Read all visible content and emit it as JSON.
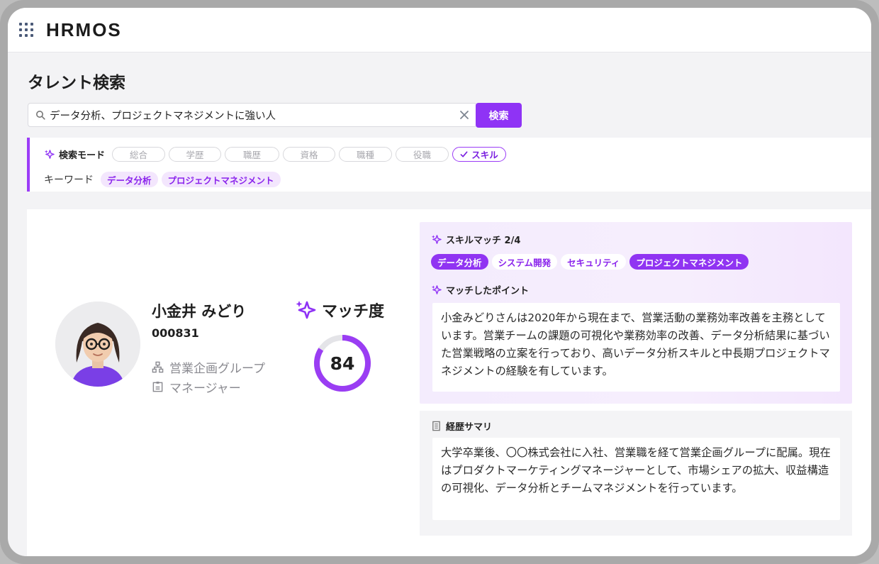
{
  "app": {
    "logo": "HRMOS"
  },
  "page": {
    "title": "タレント検索"
  },
  "search": {
    "value": "データ分析、プロジェクトマネジメントに強い人",
    "button": "検索"
  },
  "filter": {
    "mode_label": "検索モード",
    "modes": [
      "総合",
      "学歴",
      "職歴",
      "資格",
      "職種",
      "役職",
      "スキル"
    ],
    "active_mode": "スキル",
    "keyword_label": "キーワード",
    "keywords": [
      "データ分析",
      "プロジェクトマネジメント"
    ]
  },
  "result": {
    "name": "小金井 みどり",
    "employee_id": "000831",
    "department": "営業企画グループ",
    "position": "マネージャー",
    "match_label": "マッチ度",
    "match_score": 84,
    "skill_match": {
      "title": "スキルマッチ 2/4",
      "tags": [
        {
          "label": "データ分析",
          "matched": true
        },
        {
          "label": "システム開発",
          "matched": false
        },
        {
          "label": "セキュリティ",
          "matched": false
        },
        {
          "label": "プロジェクトマネジメント",
          "matched": true
        }
      ]
    },
    "points": {
      "title": "マッチしたポイント",
      "text": "小金みどりさんは2020年から現在まで、営業活動の業務効率改善を主務としています。営業チームの課題の可視化や業務効率の改善、データ分析結果に基づいた営業戦略の立案を行っており、高いデータ分析スキルと中長期プロジェクトマネジメントの経験を有しています。"
    },
    "career": {
      "title": "経歴サマリ",
      "text": "大学卒業後、〇〇株式会社に入社、営業職を経て営業企画グループに配属。現在はプロダクトマーケティングマネージャーとして、市場シェアの拡大、収益構造の可視化、データ分析とチームマネジメントを行っています。"
    }
  },
  "colors": {
    "accent": "#8f33f5",
    "accent_light": "#f3e6fd",
    "gauge_track": "#e4e4e8"
  }
}
